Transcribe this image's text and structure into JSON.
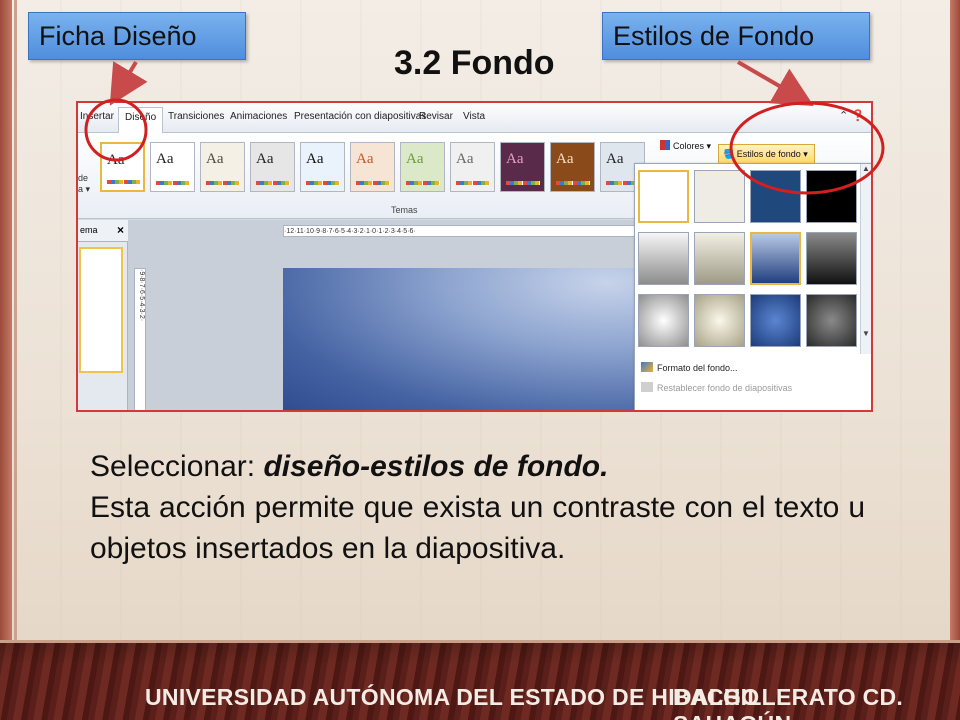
{
  "callouts": {
    "left": "Ficha Diseño",
    "right": "Estilos de Fondo"
  },
  "slide_title": "3.2 Fondo",
  "screenshot": {
    "tabs": [
      {
        "label": "Insertar"
      },
      {
        "label": "Diseño"
      },
      {
        "label": "Transiciones"
      },
      {
        "label": "Animaciones"
      },
      {
        "label": "Presentación con diapositivas"
      },
      {
        "label": "Revisar"
      },
      {
        "label": "Vista"
      }
    ],
    "ribbon": {
      "left_label_1": "de",
      "left_label_2": "a ▾",
      "themes_group_label": "Temas",
      "theme_sample": "Aa",
      "colors_label": "Colores ▾",
      "estilos_label": "Estilos de fondo ▾",
      "themes": [
        {
          "label": "Aa",
          "bg": "#ffffff",
          "fg": "#222222"
        },
        {
          "label": "Aa",
          "bg": "#ffffff",
          "fg": "#222222"
        },
        {
          "label": "Aa",
          "bg": "#f4f0e6",
          "fg": "#4a4a3a"
        },
        {
          "label": "Aa",
          "bg": "#e6e6e6",
          "fg": "#222222"
        },
        {
          "label": "Aa",
          "bg": "#eaf2fb",
          "fg": "#111111"
        },
        {
          "label": "Aa",
          "bg": "#f6e4d4",
          "fg": "#c8562a"
        },
        {
          "label": "Aa",
          "bg": "#dbe9c8",
          "fg": "#6a9a3a"
        },
        {
          "label": "Aa",
          "bg": "#f0f0f0",
          "fg": "#666666"
        },
        {
          "label": "Aa",
          "bg": "#5a2a4a",
          "fg": "#e9a0c8"
        },
        {
          "label": "Aa",
          "bg": "#8a4a1a",
          "fg": "#f4e2c8"
        },
        {
          "label": "Aa",
          "bg": "#dfe6ee",
          "fg": "#222222"
        }
      ]
    },
    "thumb_pane_header": "ema",
    "thumb_pane_close": "×",
    "hruler": "·12·11·10·9·8·7·6·5·4·3·2·1·0·1·2·3·4·5·6·",
    "vruler": "·9·8·7·6·5·4·3·2·",
    "gallery": {
      "swatches": [
        {
          "bg": "#ffffff"
        },
        {
          "bg": "#eeece4"
        },
        {
          "bg": "#1f497d"
        },
        {
          "bg": "#000000"
        },
        {
          "bg": "linear-gradient(180deg,#f6f6f6,#8c8c8c)"
        },
        {
          "bg": "linear-gradient(180deg,#f2efe4,#9e9a86)"
        },
        {
          "bg": "linear-gradient(180deg,#b8c8e6,#22407e)"
        },
        {
          "bg": "linear-gradient(180deg,#8a8a8a,#111111)"
        },
        {
          "bg": "radial-gradient(circle,#ffffff,#8e8e8e)"
        },
        {
          "bg": "radial-gradient(circle,#fbf8ea,#a7a186)"
        },
        {
          "bg": "radial-gradient(circle,#5b86d2,#1d3b7a)"
        },
        {
          "bg": "radial-gradient(circle,#8a8a8a,#2a2a2a)"
        }
      ],
      "menu": {
        "formato": "Formato del fondo...",
        "restablecer": "Restablecer fondo de diapositivas"
      }
    }
  },
  "body": {
    "line1_prefix": "Seleccionar: ",
    "line1_emphasis": "diseño-estilos de fondo.",
    "paragraph": "Esta acción permite que exista un contraste con el texto u objetos insertados en la diapositiva."
  },
  "footer": {
    "left": "UNIVERSIDAD AUTÓNOMA DEL ESTADO DE HIDALGO",
    "right": "BACHILLERATO CD. SAHAGÚN"
  }
}
